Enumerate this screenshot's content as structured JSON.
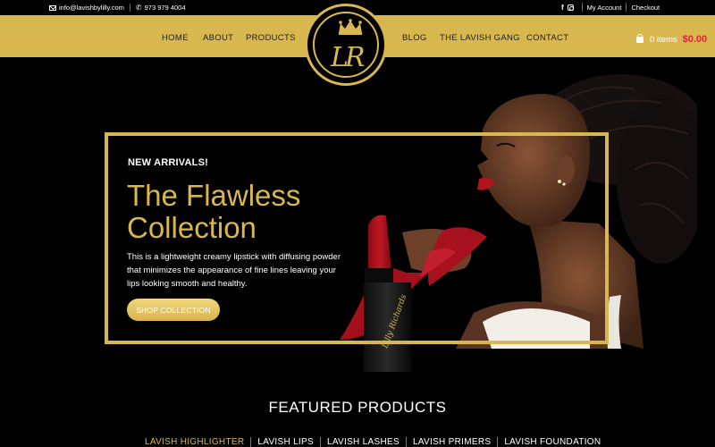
{
  "topbar": {
    "email": "info@lavishbylilly.com",
    "phone": "973 979 4004",
    "account_label": "My Account",
    "checkout_label": "Checkout",
    "social": [
      "facebook-icon",
      "instagram-icon"
    ]
  },
  "nav": {
    "items": [
      "HOME",
      "ABOUT",
      "PRODUCTS",
      "BLOG",
      "THE LAVISH GANG",
      "CONTACT"
    ],
    "logo_text": "LR",
    "cart_items": "0 items",
    "cart_total": "$0.00"
  },
  "hero": {
    "eyebrow": "NEW ARRIVALS!",
    "title": "The Flawless Collection",
    "description": "This is a lightweight creamy lipstick with diffusing powder that minimizes the appearance of fine lines leaving your lips looking smooth and healthy.",
    "button_label": "SHOP COLLECTION",
    "lipstick_brand": "Lilly Richards"
  },
  "featured": {
    "title": "FEATURED PRODUCTS",
    "tabs": [
      "LAVISH HIGHLIGHTER",
      "LAVISH LIPS",
      "LAVISH LASHES",
      "LAVISH PRIMERS",
      "LAVISH FOUNDATION"
    ]
  },
  "colors": {
    "gold": "#d9b74f",
    "background": "#000000",
    "price_red": "#e0243a",
    "lipstick_red": "#b3121f"
  }
}
